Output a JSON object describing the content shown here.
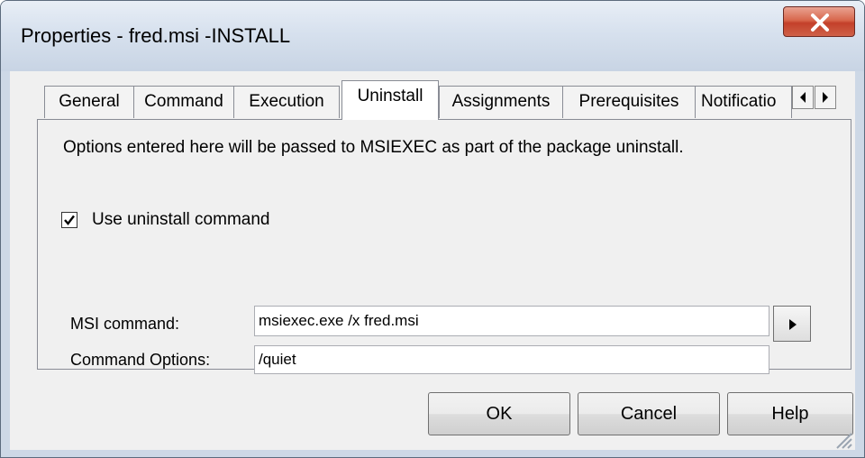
{
  "window": {
    "title": "Properties - fred.msi -INSTALL",
    "close_icon": "close-x-icon"
  },
  "tabs": [
    {
      "label": "General"
    },
    {
      "label": "Command"
    },
    {
      "label": "Execution"
    },
    {
      "label": "Uninstall",
      "active": true
    },
    {
      "label": "Assignments"
    },
    {
      "label": "Prerequisites"
    },
    {
      "label": "Notificatio"
    }
  ],
  "tab_scroll": {
    "left_icon": "arrow-left-icon",
    "right_icon": "arrow-right-icon"
  },
  "panel": {
    "info": "Options entered here will be passed to MSIEXEC as part of the package uninstall.",
    "use_uninstall": {
      "label": "Use uninstall command",
      "checked": true
    },
    "msi_command": {
      "label": "MSI command:",
      "value": "msiexec.exe /x fred.msi"
    },
    "command_options": {
      "label": "Command Options:",
      "value": "/quiet"
    }
  },
  "buttons": {
    "ok": "OK",
    "cancel": "Cancel",
    "help": "Help"
  },
  "colors": {
    "close_button": "#c3402a",
    "title_bar": "#d7e1ee"
  }
}
